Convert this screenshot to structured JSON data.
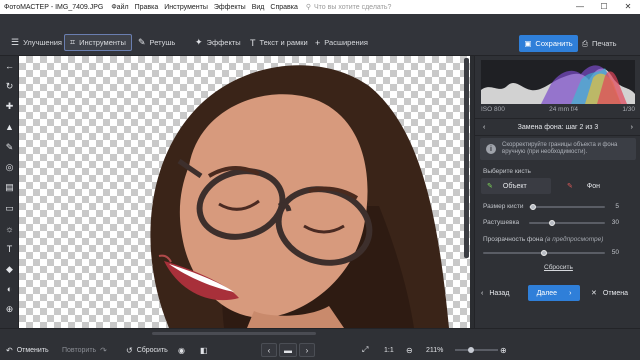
{
  "app": {
    "name": "ФотоМАСТЕР",
    "file": "IMG_7409.JPG",
    "title_separator": " - ",
    "menu": [
      "Файл",
      "Правка",
      "Инструменты",
      "Эффекты",
      "Вид",
      "Справка"
    ],
    "search_placeholder": "Что вы хотите сделать?"
  },
  "toolbar": {
    "tabs": [
      {
        "label": "Улучшения",
        "icon": "sliders-icon",
        "active": false
      },
      {
        "label": "Инструменты",
        "icon": "crop-icon",
        "active": true
      },
      {
        "label": "Ретушь",
        "icon": "brush-icon",
        "active": false
      },
      {
        "label": "Эффекты",
        "icon": "magic-wand-icon",
        "active": false
      },
      {
        "label": "Текст и рамки",
        "icon": "text-icon",
        "active": false
      },
      {
        "label": "Расширения",
        "icon": "plus-icon",
        "active": false
      }
    ],
    "save_label": "Сохранить",
    "print_label": "Печать"
  },
  "left_tools": [
    "back-arrow-icon",
    "rotate-icon",
    "healing-icon",
    "stamp-icon",
    "brush-icon",
    "target-icon",
    "gradient-icon",
    "ellipse-icon",
    "sun-icon",
    "text-icon",
    "bucket-icon",
    "globe-icon"
  ],
  "panel": {
    "exif": {
      "iso": "ISO 800",
      "lens": "24 mm f/4",
      "shutter": "1/30"
    },
    "step_title": "Замена фона: шаг 2 из 3",
    "hint": "Скорректируйте границы объекта и фона вручную (при необходимости).",
    "choose_brush": "Выберите кисть",
    "brush_object": "Объект",
    "brush_background": "Фон",
    "brush_size_label": "Размер кисти",
    "brush_size_value": "5",
    "brush_size_fraction": 0.05,
    "feather_label": "Растушевка",
    "feather_value": "30",
    "feather_fraction": 0.3,
    "transparency_label": "Прозрачность фона",
    "transparency_note": "(в предпросмотре)",
    "transparency_value": "50",
    "transparency_fraction": 0.5,
    "reset_label": "Сбросить",
    "back_label": "Назад",
    "next_label": "Далее",
    "cancel_label": "Отмена"
  },
  "bottom": {
    "cancel_label": "Отменить",
    "redo_label": "Повторить",
    "reset_label": "Сбросить",
    "zoom_fit": "1:1",
    "zoom_value": "211%"
  },
  "colors": {
    "accent": "#2f7fd9",
    "background": "#2b2d31"
  }
}
